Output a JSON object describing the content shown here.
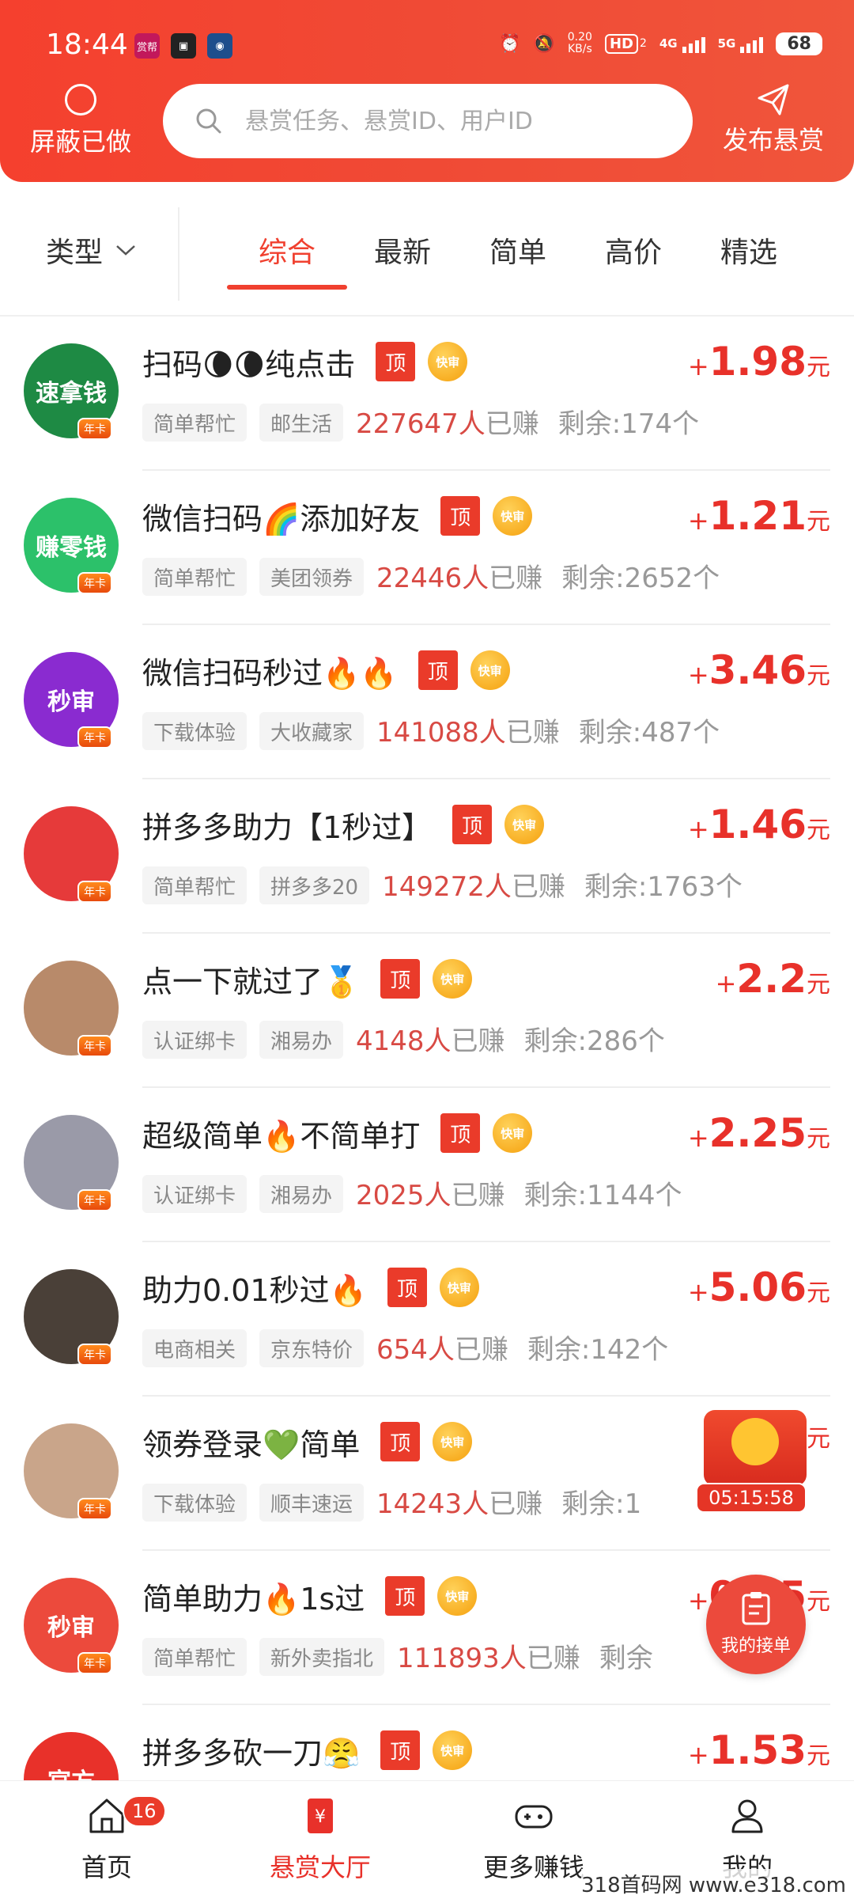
{
  "status_bar": {
    "time": "18:44",
    "apps": [
      "赏帮",
      "",
      ""
    ],
    "net_speed": "0.20",
    "net_unit": "KB/s",
    "hd": "HD",
    "hd_sub": "2",
    "sig1": "4G",
    "sig2": "5G",
    "battery": "68"
  },
  "header": {
    "shield_label": "屏蔽已做",
    "search_placeholder": "悬赏任务、悬赏ID、用户ID",
    "publish_label": "发布悬赏"
  },
  "filter": {
    "type_label": "类型",
    "tabs": [
      "综合",
      "最新",
      "简单",
      "高价",
      "精选"
    ],
    "active_tab": "综合"
  },
  "badges": {
    "ding": "顶",
    "kuaishen": "快审",
    "nianka": "年卡"
  },
  "tasks": [
    {
      "title": "扫码🌘🌘纯点击",
      "price": "1.98",
      "unit": "元",
      "tag1": "简单帮忙",
      "tag2": "邮生活",
      "count": "227647人",
      "earned_suffix": "已赚",
      "remain": "剩余:174个",
      "avatar_text": "速拿钱",
      "avatar_color": "#1e8a44"
    },
    {
      "title": "微信扫码🌈添加好友",
      "price": "1.21",
      "unit": "元",
      "tag1": "简单帮忙",
      "tag2": "美团领券",
      "count": "22446人",
      "earned_suffix": "已赚",
      "remain": "剩余:2652个",
      "avatar_text": "赚零钱",
      "avatar_color": "#2cc16a"
    },
    {
      "title": "微信扫码秒过🔥🔥",
      "price": "3.46",
      "unit": "元",
      "tag1": "下载体验",
      "tag2": "大收藏家",
      "count": "141088人",
      "earned_suffix": "已赚",
      "remain": "剩余:487个",
      "avatar_text": "秒审",
      "avatar_color": "#8a2bd0"
    },
    {
      "title": "拼多多助力【1秒过】",
      "price": "1.46",
      "unit": "元",
      "tag1": "简单帮忙",
      "tag2": "拼多多20",
      "count": "149272人",
      "earned_suffix": "已赚",
      "remain": "剩余:1763个",
      "avatar_text": "",
      "avatar_color": "#e63a3a"
    },
    {
      "title": "点一下就过了🥇",
      "price": "2.2",
      "unit": "元",
      "tag1": "认证绑卡",
      "tag2": "湘易办",
      "count": "4148人",
      "earned_suffix": "已赚",
      "remain": "剩余:286个",
      "avatar_text": "",
      "avatar_color": "#b88a6a"
    },
    {
      "title": "超级简单🔥不简单打",
      "price": "2.25",
      "unit": "元",
      "tag1": "认证绑卡",
      "tag2": "湘易办",
      "count": "2025人",
      "earned_suffix": "已赚",
      "remain": "剩余:1144个",
      "avatar_text": "",
      "avatar_color": "#9a9aa8"
    },
    {
      "title": "助力0.01秒过🔥",
      "price": "5.06",
      "unit": "元",
      "tag1": "电商相关",
      "tag2": "京东特价",
      "count": "654人",
      "earned_suffix": "已赚",
      "remain": "剩余:142个",
      "avatar_text": "",
      "avatar_color": "#4a4038"
    },
    {
      "title": "领券登录💚简单",
      "price": "",
      "unit": "元",
      "tag1": "下载体验",
      "tag2": "顺丰速运",
      "count": "14243人",
      "earned_suffix": "已赚",
      "remain": "剩余:1",
      "avatar_text": "",
      "avatar_color": "#c9a58a"
    },
    {
      "title": "简单助力🔥1s过",
      "price": "0.65",
      "unit": "元",
      "tag1": "简单帮忙",
      "tag2": "新外卖指北",
      "count": "111893人",
      "earned_suffix": "已赚",
      "remain": "剩余",
      "avatar_text": "秒审",
      "avatar_color": "#ec4a3c"
    },
    {
      "title": "拼多多砍一刀😤",
      "price": "1.53",
      "unit": "元",
      "tag1": "",
      "tag2": "",
      "count": "",
      "earned_suffix": "",
      "remain": "",
      "avatar_text": "官方",
      "avatar_color": "#e8312a"
    }
  ],
  "floating": {
    "timer": "05:15:58",
    "my_orders": "我的接单"
  },
  "nav": {
    "home": "首页",
    "home_badge": "16",
    "hall": "悬赏大厅",
    "more": "更多赚钱",
    "mine": "我的"
  },
  "watermark": "318首码网 www.e318.com"
}
